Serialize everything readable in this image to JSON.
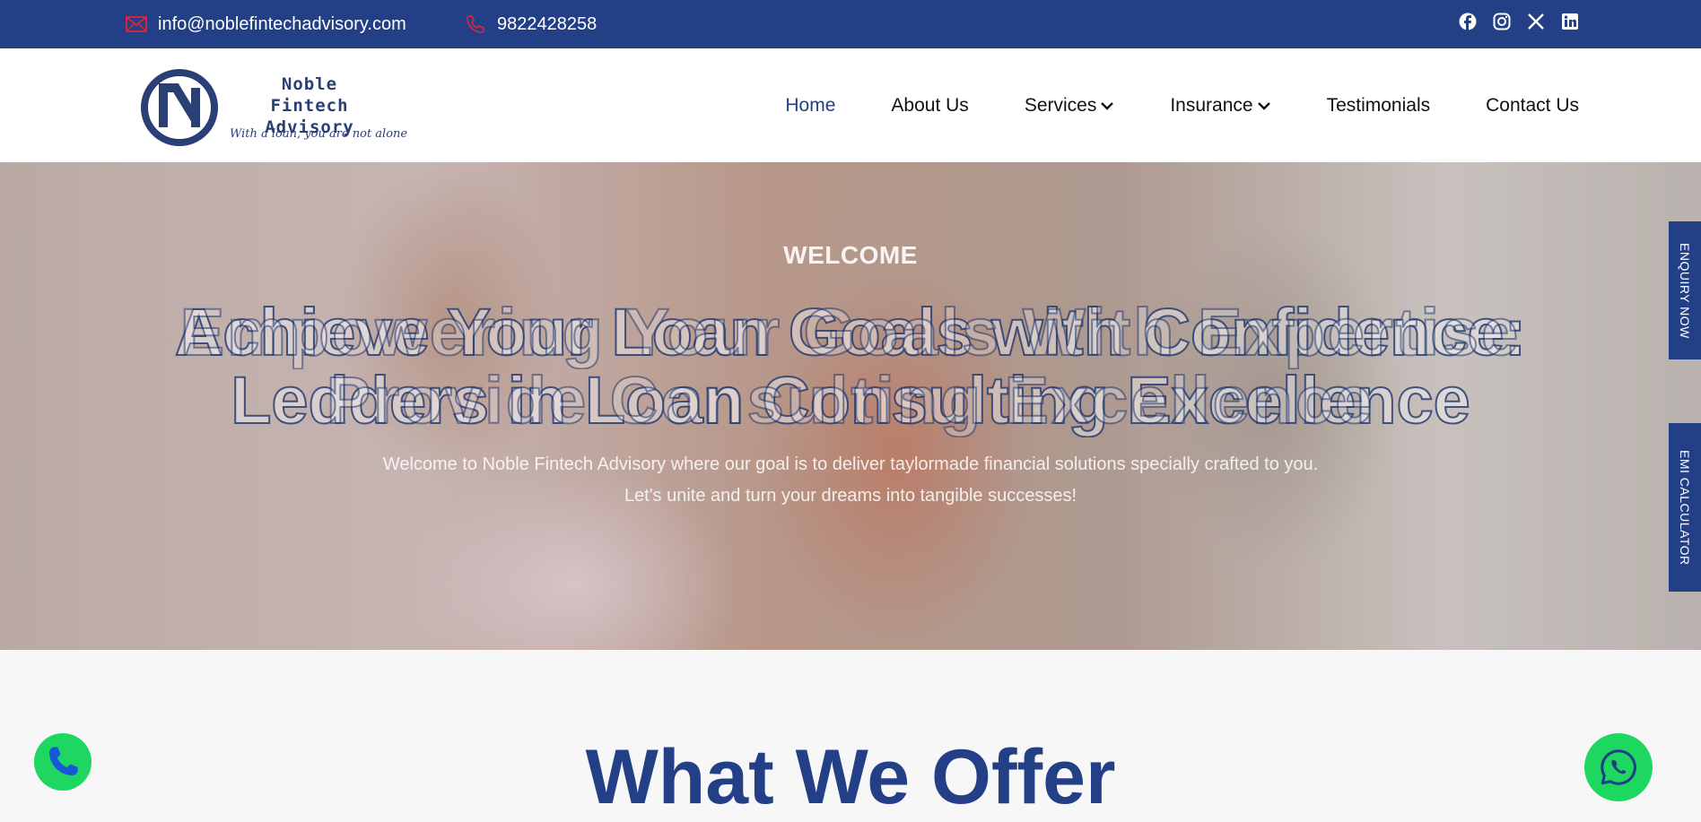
{
  "topbar": {
    "email": "info@noblefintechadvisory.com",
    "phone": "9822428258",
    "social_icons": [
      "facebook-icon",
      "instagram-icon",
      "x-icon",
      "linkedin-icon"
    ]
  },
  "logo": {
    "name_line1": "Noble Fintech",
    "name_line2": "Advisory",
    "tagline": "With a loan, you are not alone"
  },
  "nav": {
    "items": [
      {
        "label": "Home",
        "active": true
      },
      {
        "label": "About Us"
      },
      {
        "label": "Services",
        "dropdown": true
      },
      {
        "label": "Insurance",
        "dropdown": true
      },
      {
        "label": "Testimonials"
      },
      {
        "label": "Contact Us"
      }
    ]
  },
  "hero": {
    "welcome": "WELCOME",
    "headline_a_line1": "Achieve Your Loan Goals with Confidence:",
    "headline_a_line2": "Ledders in Loan Consulting Excellence",
    "headline_b_line1": "Empowering Your Goals With Expertise",
    "headline_b_line2": "Provide Consulting Excellence",
    "text_line1": "Welcome to Noble Fintech Advisory where our goal is to deliver taylormade financial solutions specially crafted to you.",
    "text_line2": "Let's unite and turn your dreams into tangible successes!"
  },
  "side_tabs": {
    "enquiry": "ENQUIRY NOW",
    "emi": "EMI CALCULATOR"
  },
  "offer": {
    "title": "What We Offer"
  },
  "colors": {
    "brand": "#233f85",
    "accent_icon": "#e0243b",
    "whatsapp": "#1ed760"
  }
}
